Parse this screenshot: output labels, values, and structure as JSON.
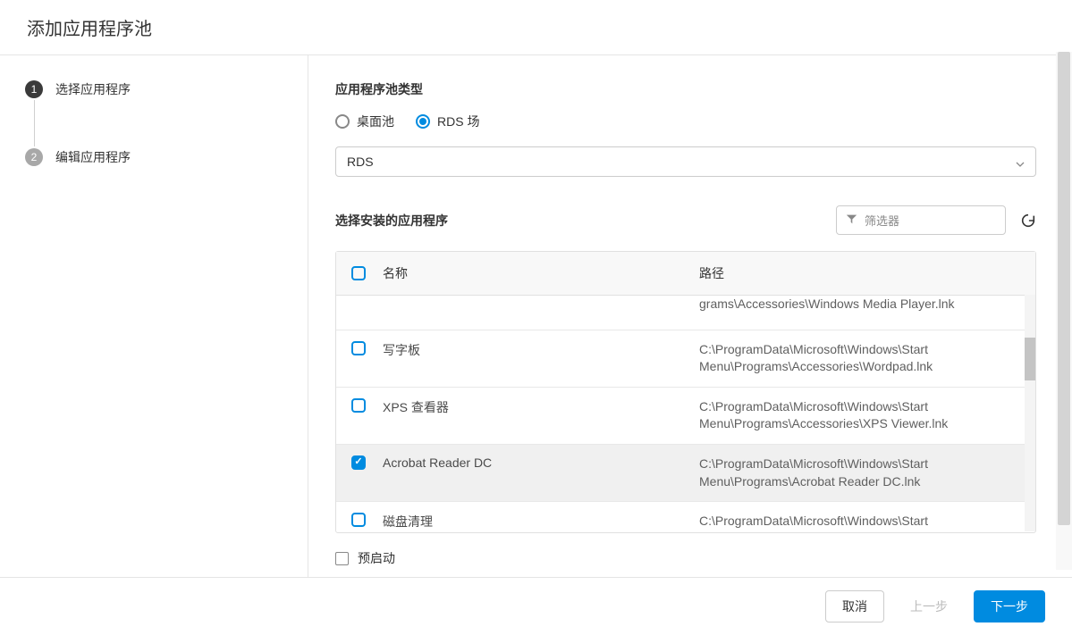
{
  "header": {
    "title": "添加应用程序池"
  },
  "sidebar": {
    "steps": [
      {
        "num": "1",
        "label": "选择应用程序",
        "active": true
      },
      {
        "num": "2",
        "label": "编辑应用程序",
        "active": false
      }
    ]
  },
  "content": {
    "pool_type_label": "应用程序池类型",
    "radio_options": [
      {
        "label": "桌面池",
        "checked": false
      },
      {
        "label": "RDS 场",
        "checked": true
      }
    ],
    "select_value": "RDS",
    "installed_apps_label": "选择安装的应用程序",
    "filter_placeholder": "筛选器",
    "table": {
      "columns": {
        "name": "名称",
        "path": "路径"
      },
      "partial_top": "grams\\Accessories\\Windows Media Player.lnk",
      "rows": [
        {
          "name": "写字板",
          "path": "C:\\ProgramData\\Microsoft\\Windows\\Start Menu\\Programs\\Accessories\\Wordpad.lnk",
          "checked": false
        },
        {
          "name": "XPS 查看器",
          "path": "C:\\ProgramData\\Microsoft\\Windows\\Start Menu\\Programs\\Accessories\\XPS Viewer.lnk",
          "checked": false
        },
        {
          "name": "Acrobat Reader DC",
          "path": "C:\\ProgramData\\Microsoft\\Windows\\Start Menu\\Programs\\Acrobat Reader DC.lnk",
          "checked": true
        },
        {
          "name": "磁盘清理",
          "path": "C:\\ProgramData\\Microsoft\\Windows\\Start Menu\\Programs\\Administrative Tools\\Disk Cleanup.lnk",
          "checked": false
        }
      ]
    },
    "prelaunch_label": "预启动"
  },
  "footer": {
    "cancel": "取消",
    "prev": "上一步",
    "next": "下一步"
  }
}
